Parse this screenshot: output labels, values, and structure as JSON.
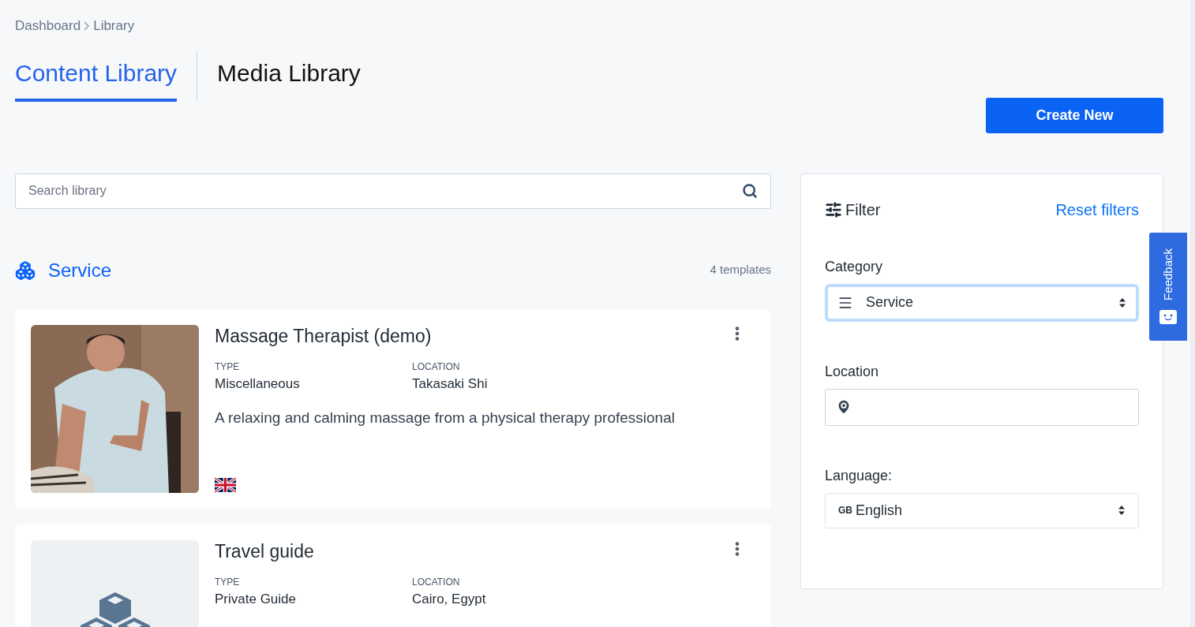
{
  "breadcrumb": [
    "Dashboard",
    "Library"
  ],
  "tabs": [
    {
      "label": "Content Library",
      "selected": true
    },
    {
      "label": "Media Library",
      "selected": false
    }
  ],
  "create_button": "Create New",
  "search": {
    "placeholder": "Search library"
  },
  "section": {
    "title": "Service",
    "count": "4 templates"
  },
  "cards": [
    {
      "title": "Massage Therapist (demo)",
      "type_label": "TYPE",
      "type": "Miscellaneous",
      "location_label": "LOCATION",
      "location": "Takasaki Shi",
      "description": "A relaxing and calming massage from a physical therapy professional",
      "flag": true
    },
    {
      "kind": "placeholder",
      "title": "Travel guide",
      "type_label": "TYPE",
      "type": "Private Guide",
      "location_label": "LOCATION",
      "location": "Cairo, Egypt",
      "flag": false
    }
  ],
  "filter": {
    "title": "Filter",
    "reset": "Reset filters",
    "category_label": "Category",
    "category": "Service",
    "category_focused": true,
    "location_label": "Location",
    "language_label": "Language:",
    "language_code": "GB",
    "language": "English"
  },
  "feedback": "Feedback"
}
